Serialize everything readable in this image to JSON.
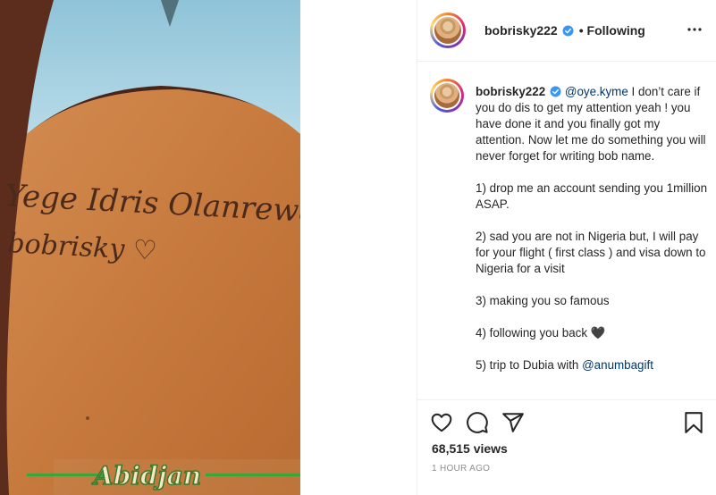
{
  "post": {
    "username": "bobrisky222",
    "verified": true,
    "follow_separator": "•",
    "follow_status": "Following",
    "more_icon": "more-icon"
  },
  "caption": {
    "username": "bobrisky222",
    "mention": "@oye.kyme",
    "intro": " I don’t care if you do dis to get my attention yeah ! you have done it and you finally got my attention. Now let me do something you will never forget for writing bob name.",
    "items": [
      "1) drop me an account sending you 1million ASAP.",
      "2) sad you are not in Nigeria but, I will pay for your flight ( first class ) and visa down to Nigeria for a visit",
      "3) making you so famous",
      "4) following you back 🖤",
      "5) trip to Dubia with "
    ],
    "last_mention": "@anumbagift"
  },
  "media": {
    "tattoo_line1": "Yege Idris Olanrewaju",
    "tattoo_line2": "bobrisky ♡",
    "location_overlay": "Abidjan"
  },
  "actions": {
    "icons": [
      "heart-icon",
      "comment-icon",
      "share-icon",
      "bookmark-icon"
    ]
  },
  "stats": {
    "views": "68,515 views",
    "timestamp": "1 HOUR AGO"
  },
  "colors": {
    "link": "#00376b",
    "verified_blue": "#3897f0",
    "secondary_text": "#8e8e8e"
  }
}
